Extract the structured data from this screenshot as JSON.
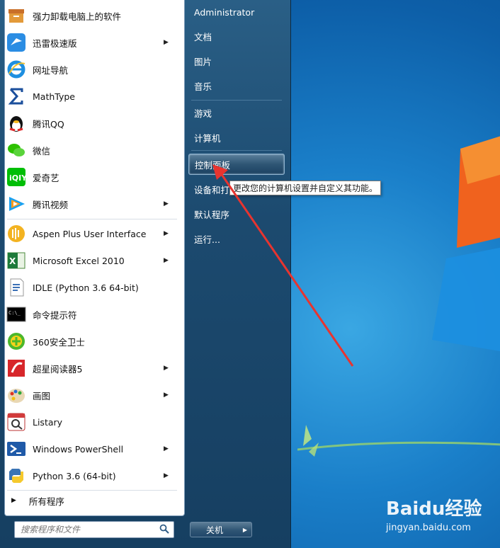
{
  "start_menu": {
    "programs": [
      {
        "label": "强力卸载电脑上的软件",
        "icon": "uninstall-box-icon",
        "has_submenu": false
      },
      {
        "label": "迅雷极速版",
        "icon": "xunlei-bird-icon",
        "has_submenu": true
      },
      {
        "label": "网址导航",
        "icon": "ie-icon",
        "has_submenu": false
      },
      {
        "label": "MathType",
        "icon": "sigma-icon",
        "has_submenu": false
      },
      {
        "label": "腾讯QQ",
        "icon": "qq-penguin-icon",
        "has_submenu": false
      },
      {
        "label": "微信",
        "icon": "wechat-icon",
        "has_submenu": false
      },
      {
        "label": "爱奇艺",
        "icon": "iqiyi-icon",
        "has_submenu": false
      },
      {
        "label": "腾讯视频",
        "icon": "tencent-video-icon",
        "has_submenu": true
      },
      {
        "label": "Aspen Plus User Interface",
        "icon": "aspen-icon",
        "has_submenu": true
      },
      {
        "label": "Microsoft Excel 2010",
        "icon": "excel-icon",
        "has_submenu": true
      },
      {
        "label": "IDLE (Python 3.6 64-bit)",
        "icon": "idle-icon",
        "has_submenu": false
      },
      {
        "label": "命令提示符",
        "icon": "cmd-icon",
        "has_submenu": false
      },
      {
        "label": "360安全卫士",
        "icon": "360-icon",
        "has_submenu": false
      },
      {
        "label": "超星阅读器5",
        "icon": "ssreader-icon",
        "has_submenu": true
      },
      {
        "label": "画图",
        "icon": "paint-palette-icon",
        "has_submenu": true
      },
      {
        "label": "Listary",
        "icon": "listary-icon",
        "has_submenu": false
      },
      {
        "label": "Windows PowerShell",
        "icon": "powershell-icon",
        "has_submenu": true
      },
      {
        "label": "Python 3.6 (64-bit)",
        "icon": "python-icon",
        "has_submenu": true
      }
    ],
    "all_programs": "所有程序",
    "search_placeholder": "搜索程序和文件",
    "right_items": {
      "user": "Administrator",
      "documents": "文档",
      "pictures": "图片",
      "music": "音乐",
      "games": "游戏",
      "computer": "计算机",
      "control_panel": "控制面板",
      "devices": "设备和打",
      "default_programs": "默认程序",
      "run": "运行..."
    },
    "shutdown_label": "关机",
    "tooltip": "更改您的计算机设置并自定义其功能。"
  },
  "watermark": {
    "brand": "Baidu经验",
    "url": "jingyan.baidu.com"
  },
  "colors": {
    "annotation_arrow": "#e8342f",
    "desktop_blue": "#1a7fc9"
  }
}
